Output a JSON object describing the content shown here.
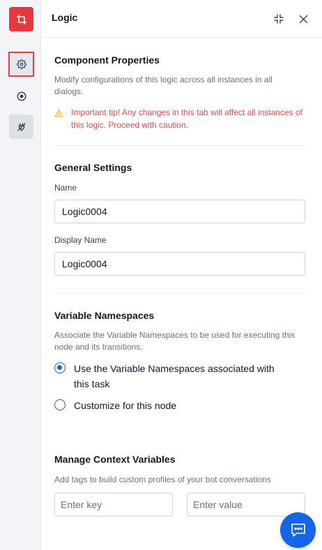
{
  "header": {
    "title": "Logic"
  },
  "rail": {
    "icons": [
      "logic-node-icon",
      "gear-icon",
      "target-icon",
      "plug-icon"
    ]
  },
  "component_properties": {
    "title": "Component Properties",
    "description": "Modify configurations of this logic across all instances in all dialogs.",
    "tip": "Important tip! Any changes in this tab will affect all instances of this logic. Proceed with caution."
  },
  "general_settings": {
    "title": "General Settings",
    "name_label": "Name",
    "name_value": "Logic0004",
    "display_name_label": "Display Name",
    "display_name_value": "Logic0004"
  },
  "variable_namespaces": {
    "title": "Variable Namespaces",
    "description": "Associate the Variable Namespaces to be used for executing this node and its transitions.",
    "options": [
      {
        "label": "Use the Variable Namespaces associated with this task",
        "selected": true
      },
      {
        "label": "Customize for this node",
        "selected": false
      }
    ]
  },
  "context_variables": {
    "title": "Manage Context Variables",
    "description": "Add tags to build custom profiles of your bot conversations",
    "key_placeholder": "Enter key",
    "value_placeholder": "Enter value"
  },
  "colors": {
    "accent": "#1565e8",
    "danger": "#e5393d",
    "tip": "#e0474b"
  }
}
